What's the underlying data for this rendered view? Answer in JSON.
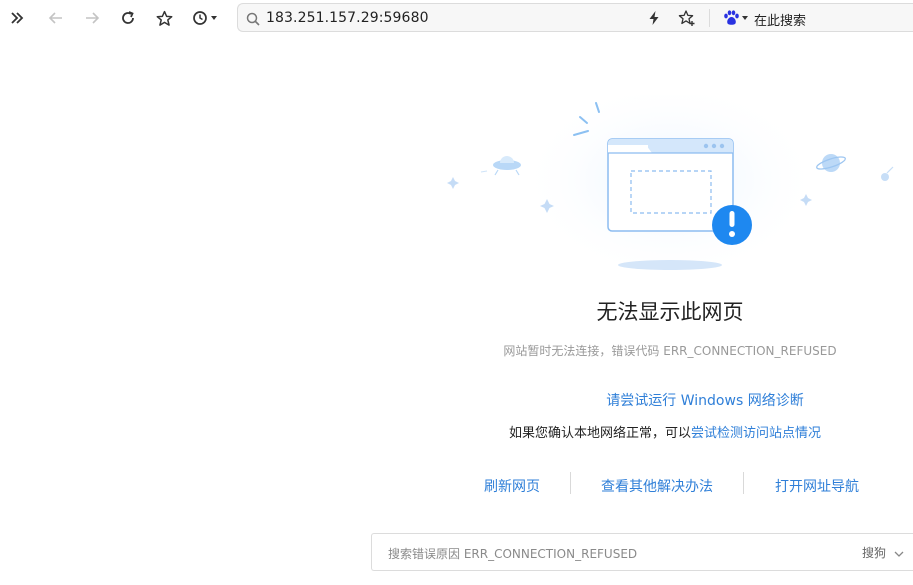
{
  "toolbar": {
    "address": "183.251.157.29:59680",
    "search_engine_label": "在此搜索"
  },
  "error_page": {
    "title": "无法显示此网页",
    "subtitle": "网站暂时无法连接，错误代码 ERR_CONNECTION_REFUSED",
    "diagnose_link": "请尝试运行 Windows 网络诊断",
    "check_prefix": "如果您确认本地网络正常，可以",
    "check_link": "尝试检测访问站点情况",
    "actions": [
      "刷新网页",
      "查看其他解决办法",
      "打开网址导航"
    ],
    "search_placeholder": "搜索错误原因 ERR_CONNECTION_REFUSED",
    "search_engine": "搜狗"
  },
  "colors": {
    "link": "#2f7fd8",
    "alert": "#1e88f0",
    "baidu": "#2932e1"
  }
}
